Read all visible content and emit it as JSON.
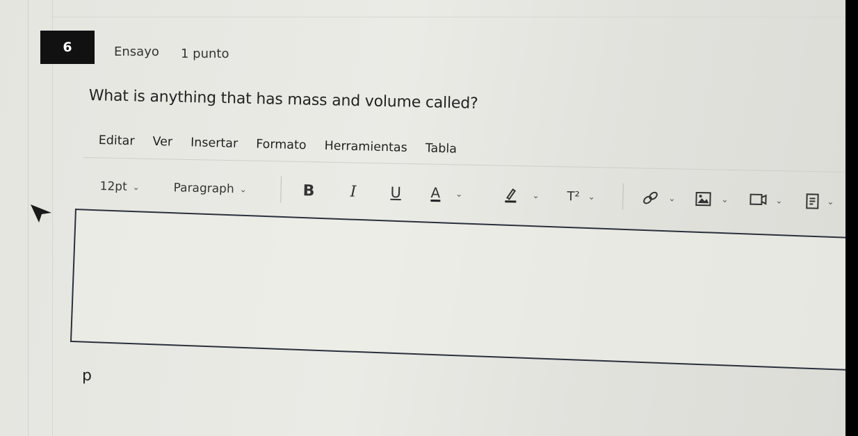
{
  "question": {
    "number": "6",
    "type": "Ensayo",
    "points": "1 punto",
    "text": "What is anything that has mass and volume called?"
  },
  "menubar": {
    "items": [
      {
        "label": "Editar"
      },
      {
        "label": "Ver"
      },
      {
        "label": "Insertar"
      },
      {
        "label": "Formato"
      },
      {
        "label": "Herramientas"
      },
      {
        "label": "Tabla"
      }
    ]
  },
  "toolbar": {
    "font_size": "12pt",
    "block_format": "Paragraph",
    "bold": "B",
    "italic": "I",
    "underline": "U",
    "text_color": "A",
    "superscript": "T²"
  },
  "editor": {
    "content": ""
  },
  "status_path": "p",
  "colors": {
    "question_badge": "#111111",
    "editor_border": "#2a2f3a",
    "page_background": "#e7e7e2"
  }
}
